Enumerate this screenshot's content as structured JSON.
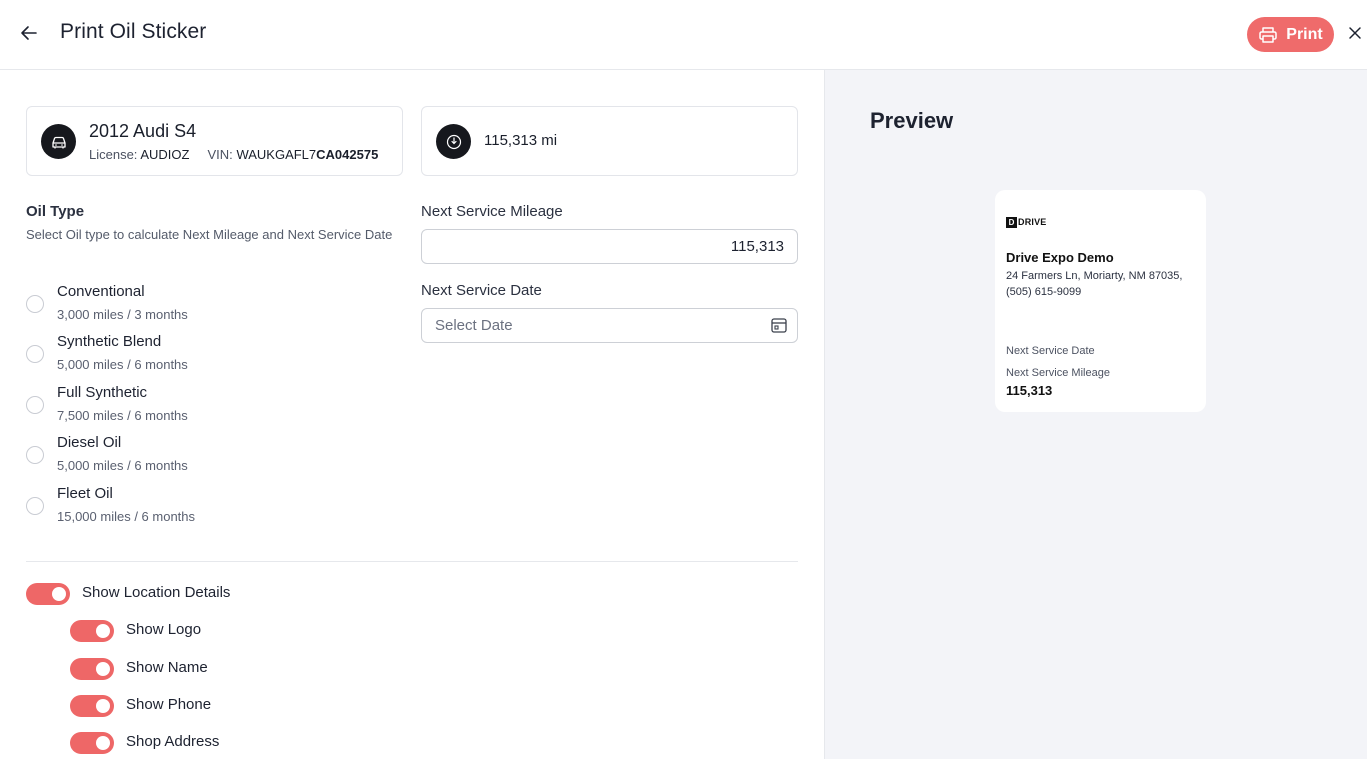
{
  "header": {
    "title": "Print Oil Sticker",
    "print_label": "Print"
  },
  "vehicle": {
    "name": "2012 Audi S4",
    "license_label": "License:",
    "license": "AUDIOZ",
    "vin_label": "VIN:",
    "vin_prefix": "WAUKGAFL7",
    "vin_suffix": "CA042575",
    "mileage": "115,313 mi"
  },
  "oil_type": {
    "title": "Oil Type",
    "description": "Select Oil type to calculate Next Mileage and Next Service Date",
    "options": [
      {
        "label": "Conventional",
        "detail": "3,000 miles / 3 months"
      },
      {
        "label": "Synthetic Blend",
        "detail": "5,000 miles / 6 months"
      },
      {
        "label": "Full Synthetic",
        "detail": "7,500 miles / 6 months"
      },
      {
        "label": "Diesel Oil",
        "detail": "5,000 miles / 6 months"
      },
      {
        "label": "Fleet Oil",
        "detail": "15,000 miles / 6 months"
      }
    ]
  },
  "next_service": {
    "mileage_label": "Next Service Mileage",
    "mileage_value": "115,313",
    "date_label": "Next Service Date",
    "date_placeholder": "Select Date"
  },
  "toggles": [
    {
      "label": "Show Location Details",
      "on": true
    },
    {
      "label": "Show Logo",
      "on": true
    },
    {
      "label": "Show Name",
      "on": true
    },
    {
      "label": "Show Phone",
      "on": true
    },
    {
      "label": "Shop Address",
      "on": true
    }
  ],
  "preview": {
    "title": "Preview",
    "logo_mark": "D",
    "logo_text": "DRIVE",
    "shop_name": "Drive Expo Demo",
    "shop_address": "24 Farmers Ln, Moriarty, NM 87035, (505) 615-9099",
    "next_date_label": "Next Service Date",
    "next_mileage_label": "Next Service Mileage",
    "next_mileage_value": "115,313"
  },
  "colors": {
    "accent": "#ef6b6b",
    "preview_bg": "#f3f4f8"
  }
}
